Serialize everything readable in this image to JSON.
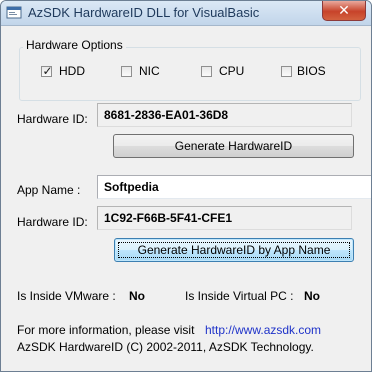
{
  "window": {
    "title": "AzSDK HardwareID DLL for VisualBasic",
    "close_label": "✕"
  },
  "hardware_options": {
    "title": "Hardware Options",
    "items": [
      {
        "label": "HDD",
        "checked": true
      },
      {
        "label": "NIC",
        "checked": false
      },
      {
        "label": "CPU",
        "checked": false
      },
      {
        "label": "BIOS",
        "checked": false
      }
    ]
  },
  "hardware_id": {
    "label": "Hardware ID:",
    "value": "8681-2836-EA01-36D8",
    "button": "Generate HardwareID"
  },
  "app_name": {
    "label": "App Name :",
    "value": "Softpedia"
  },
  "app_hardware_id": {
    "label": "Hardware ID:",
    "value": "1C92-F66B-5F41-CFE1",
    "button": "Generate HardwareID by App Name"
  },
  "vm_status": {
    "vmware_label": "Is Inside VMware :",
    "vmware_value": "No",
    "virtualpc_label": "Is Inside Virtual PC :",
    "virtualpc_value": "No"
  },
  "footer": {
    "info_text": "For more information, please visit",
    "link": "http://www.azsdk.com",
    "copyright": "AzSDK HardwareID  (C) 2002-2011, AzSDK Technology."
  }
}
